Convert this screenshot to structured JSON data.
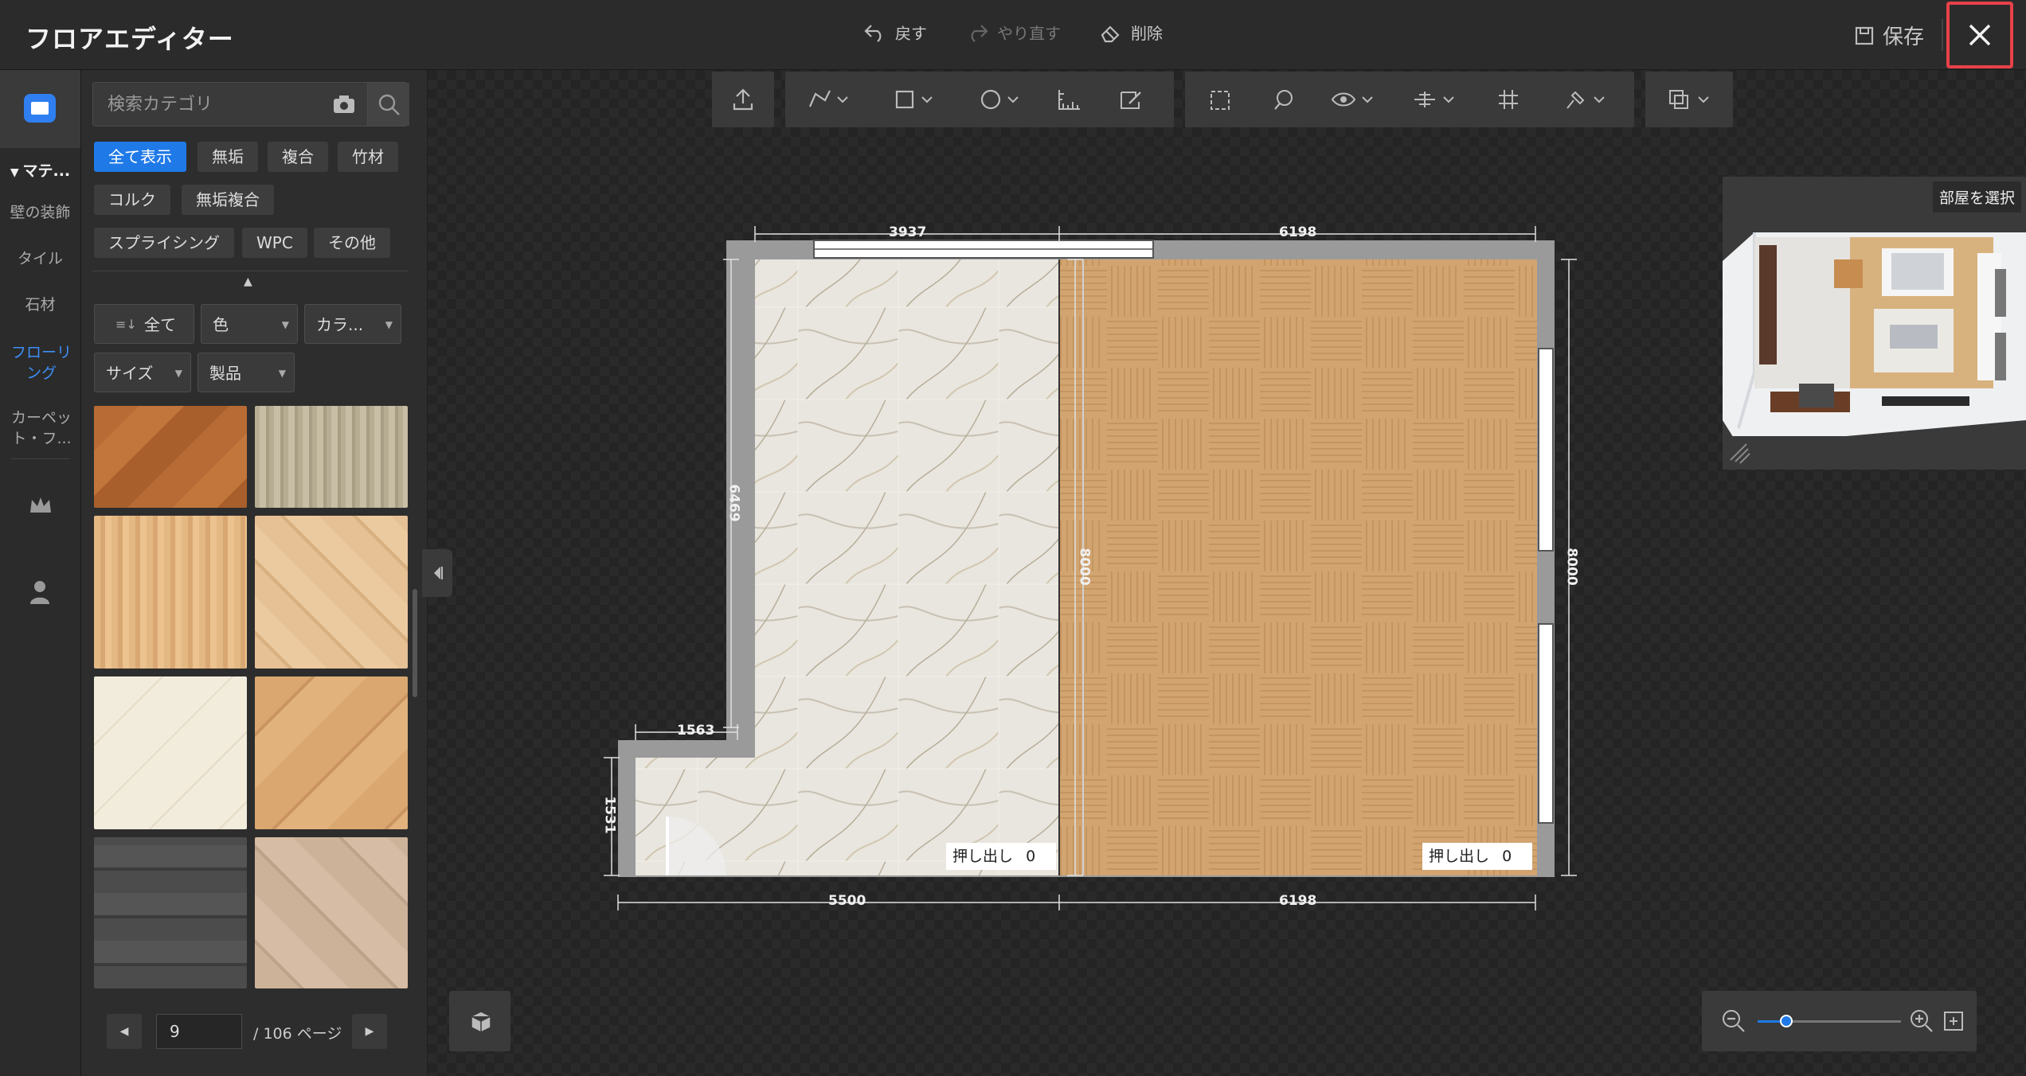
{
  "app": {
    "title": "フロアエディター"
  },
  "toolbar": {
    "undo": "戻す",
    "redo": "やり直す",
    "delete": "削除",
    "save": "保存"
  },
  "rail": {
    "materials_header": "マテ...",
    "items": [
      {
        "label": "壁の装飾"
      },
      {
        "label": "タイル"
      },
      {
        "label": "石材"
      },
      {
        "label": "フローリング",
        "active": true
      },
      {
        "label": "カーペット・フ..."
      }
    ]
  },
  "search": {
    "placeholder": "検索カテゴリ"
  },
  "filters": {
    "chips": [
      "全て表示",
      "無垢",
      "複合",
      "竹材",
      "コルク",
      "無垢複合",
      "スプライシング",
      "WPC",
      "その他"
    ],
    "sort_all": "全て",
    "color": "色",
    "color_scheme": "カラ...",
    "size": "サイズ",
    "product": "製品"
  },
  "pagination": {
    "current": "9",
    "total_label": "/ 106 ページ"
  },
  "plan": {
    "dims": {
      "top_left": "3937",
      "top_right": "6198",
      "left": "6469",
      "middle": "8000",
      "right": "8000",
      "step_top": "1563",
      "step_left": "1531",
      "bottom_left": "5500",
      "bottom_right": "6198"
    },
    "extrude_label": "押し出し",
    "extrude_value_left": "0",
    "extrude_value_right": "0"
  },
  "minimap": {
    "select_room": "部屋を選択"
  },
  "zoom": {
    "level": 0.2
  },
  "colors": {
    "accent": "#1f7ae8",
    "highlight": "#e8414a"
  }
}
